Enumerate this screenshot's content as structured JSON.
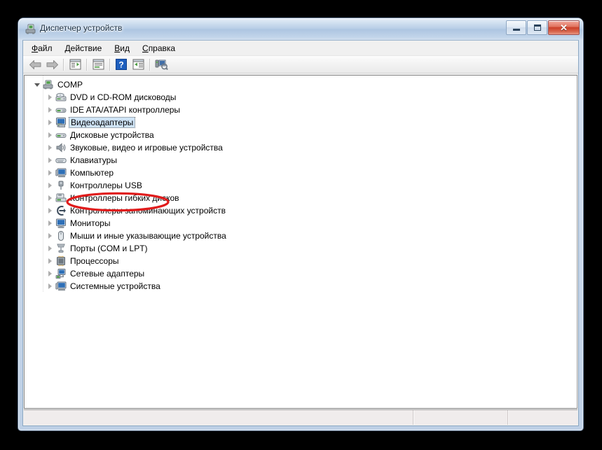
{
  "window": {
    "title": "Диспетчер устройств",
    "title_icon": "device-manager-icon",
    "controls": {
      "minimize": "minimize-button",
      "maximize": "maximize-button",
      "close": "close-button",
      "close_glyph": "✕"
    }
  },
  "menubar": {
    "items": [
      {
        "label": "Файл",
        "accel": "Ф",
        "rest": "айл"
      },
      {
        "label": "Действие",
        "accel": "Д",
        "rest": "ействие"
      },
      {
        "label": "Вид",
        "accel": "В",
        "rest": "ид"
      },
      {
        "label": "Справка",
        "accel": "С",
        "rest": "правка"
      }
    ]
  },
  "toolbar": {
    "buttons": [
      {
        "name": "back-arrow-icon",
        "kind": "back"
      },
      {
        "name": "forward-arrow-icon",
        "kind": "forward"
      },
      {
        "name": "separator-1",
        "kind": "sep"
      },
      {
        "name": "show-hide-console-tree-icon",
        "kind": "tree"
      },
      {
        "name": "separator-2",
        "kind": "sep"
      },
      {
        "name": "properties-icon",
        "kind": "props"
      },
      {
        "name": "separator-3",
        "kind": "sep"
      },
      {
        "name": "help-icon",
        "kind": "help"
      },
      {
        "name": "update-driver-icon",
        "kind": "update"
      },
      {
        "name": "separator-4",
        "kind": "sep"
      },
      {
        "name": "scan-for-hardware-changes-icon",
        "kind": "scan"
      }
    ]
  },
  "tree": {
    "root": {
      "label": "COMP",
      "icon": "computer-root-icon",
      "expanded": true,
      "indent": 0
    },
    "items": [
      {
        "label": "DVD и CD-ROM дисководы",
        "icon": "dvd-drive-icon",
        "expanded": false,
        "selected": false
      },
      {
        "label": "IDE ATA/ATAPI контроллеры",
        "icon": "ide-controller-icon",
        "expanded": false,
        "selected": false
      },
      {
        "label": "Видеоадаптеры",
        "icon": "display-adapter-icon",
        "expanded": false,
        "selected": true
      },
      {
        "label": "Дисковые устройства",
        "icon": "disk-drive-icon",
        "expanded": false,
        "selected": false
      },
      {
        "label": "Звуковые, видео и игровые устройства",
        "icon": "sound-device-icon",
        "expanded": false,
        "selected": false
      },
      {
        "label": "Клавиатуры",
        "icon": "keyboard-icon",
        "expanded": false,
        "selected": false
      },
      {
        "label": "Компьютер",
        "icon": "computer-icon",
        "expanded": false,
        "selected": false
      },
      {
        "label": "Контроллеры USB",
        "icon": "usb-controller-icon",
        "expanded": false,
        "selected": false
      },
      {
        "label": "Контроллеры гибких дисков",
        "icon": "floppy-controller-icon",
        "expanded": false,
        "selected": false
      },
      {
        "label": "Контроллеры запоминающих устройств",
        "icon": "storage-controller-icon",
        "expanded": false,
        "selected": false
      },
      {
        "label": "Мониторы",
        "icon": "monitor-icon",
        "expanded": false,
        "selected": false
      },
      {
        "label": "Мыши и иные указывающие устройства",
        "icon": "mouse-icon",
        "expanded": false,
        "selected": false
      },
      {
        "label": "Порты (COM и LPT)",
        "icon": "port-icon",
        "expanded": false,
        "selected": false
      },
      {
        "label": "Процессоры",
        "icon": "processor-icon",
        "expanded": false,
        "selected": false
      },
      {
        "label": "Сетевые адаптеры",
        "icon": "network-adapter-icon",
        "expanded": false,
        "selected": false
      },
      {
        "label": "Системные устройства",
        "icon": "system-device-icon",
        "expanded": false,
        "selected": false
      }
    ]
  },
  "statusbar": {
    "panels": [
      "",
      "",
      ""
    ]
  },
  "annotation": {
    "shape": "ellipse",
    "target": "Видеоадаптеры",
    "color": "#e01b1b"
  },
  "colors": {
    "desktop_background": "#000000",
    "title_text": "#1b3043",
    "selection_fill": "#cfe4f7",
    "annotation_red": "#e01b1b",
    "tree_background": "#ffffff"
  }
}
